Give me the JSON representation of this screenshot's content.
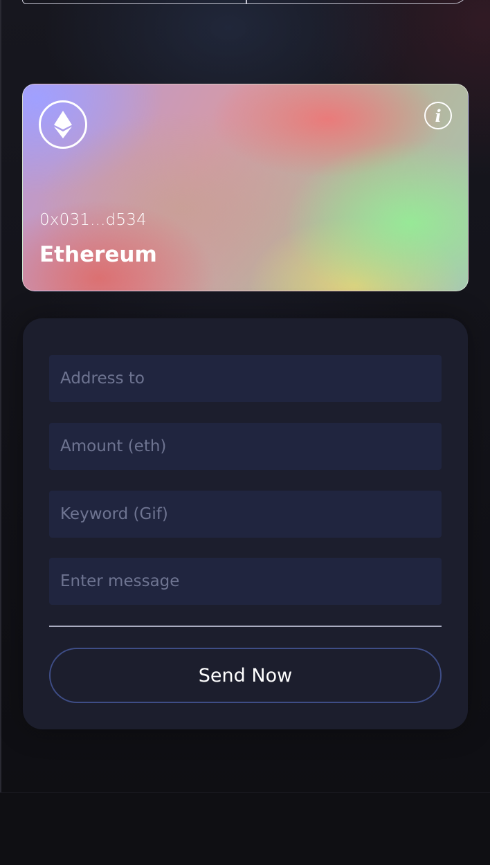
{
  "card": {
    "address": "0x031...d534",
    "network": "Ethereum",
    "info_glyph": "i",
    "icons": {
      "logo": "ethereum-icon",
      "info": "info-icon"
    }
  },
  "form": {
    "address_placeholder": "Address to",
    "amount_placeholder": "Amount (eth)",
    "keyword_placeholder": "Keyword (Gif)",
    "message_placeholder": "Enter message",
    "submit_label": "Send Now"
  },
  "colors": {
    "background": "#121218",
    "panel": "#1c1e2d",
    "field": "#20253f",
    "button_border": "#3e4d86"
  }
}
